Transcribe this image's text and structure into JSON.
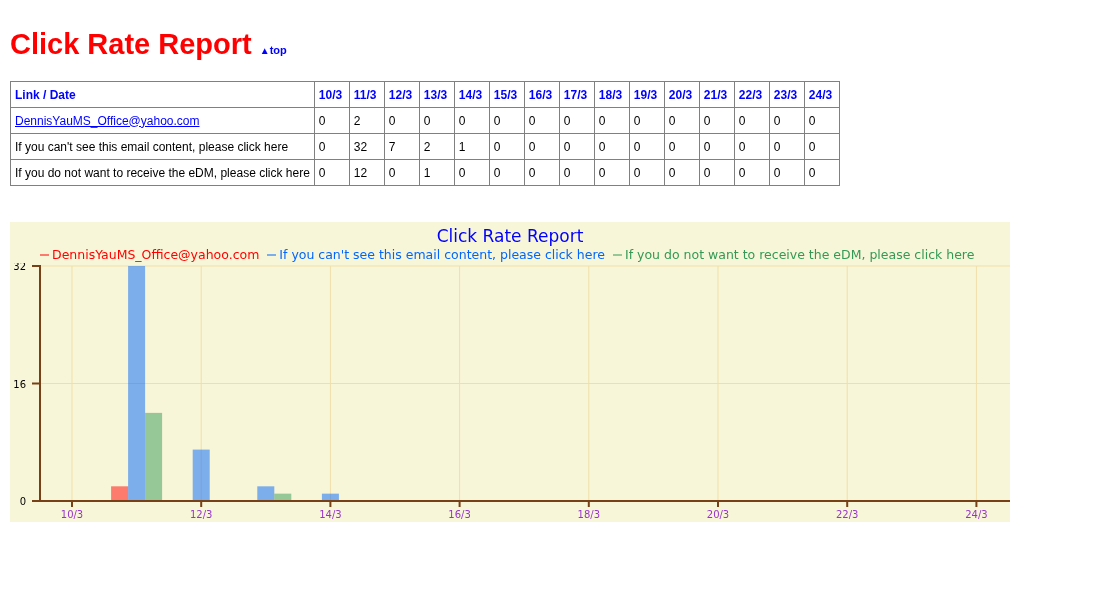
{
  "title": "Click Rate Report",
  "top_link": {
    "icon": "▲",
    "label": "top"
  },
  "table": {
    "columns": [
      "Link / Date",
      "10/3",
      "11/3",
      "12/3",
      "13/3",
      "14/3",
      "15/3",
      "16/3",
      "17/3",
      "18/3",
      "19/3",
      "20/3",
      "21/3",
      "22/3",
      "23/3",
      "24/3"
    ],
    "rows": [
      {
        "kind": "link",
        "cells": [
          "DennisYauMS_Office@yahoo.com",
          "0",
          "2",
          "0",
          "0",
          "0",
          "0",
          "0",
          "0",
          "0",
          "0",
          "0",
          "0",
          "0",
          "0",
          "0"
        ]
      },
      {
        "kind": "text",
        "cells": [
          "If you can't see this email content, please click here",
          "0",
          "32",
          "7",
          "2",
          "1",
          "0",
          "0",
          "0",
          "0",
          "0",
          "0",
          "0",
          "0",
          "0",
          "0"
        ]
      },
      {
        "kind": "text",
        "cells": [
          "If you do not want to receive the eDM, please click here",
          "0",
          "12",
          "0",
          "1",
          "0",
          "0",
          "0",
          "0",
          "0",
          "0",
          "0",
          "0",
          "0",
          "0",
          "0"
        ]
      }
    ]
  },
  "chart_data": {
    "type": "bar",
    "title": "Click Rate Report",
    "categories": [
      "10/3",
      null,
      "12/3",
      null,
      "14/3",
      null,
      "16/3",
      null,
      "18/3",
      null,
      "20/3",
      null,
      "22/3",
      null,
      "24/3"
    ],
    "series": [
      {
        "name": "DennisYauMS_Office@yahoo.com",
        "color": "#ff0000",
        "values": [
          0,
          2,
          0,
          0,
          0,
          0,
          0,
          0,
          0,
          0,
          0,
          0,
          0,
          0,
          0
        ]
      },
      {
        "name": "If you can't see this email content, please click here",
        "color": "#0066ff",
        "values": [
          0,
          32,
          7,
          2,
          1,
          0,
          0,
          0,
          0,
          0,
          0,
          0,
          0,
          0,
          0
        ]
      },
      {
        "name": "If you do not want to receive the eDM, please click here",
        "color": "#339955",
        "values": [
          0,
          12,
          0,
          1,
          0,
          0,
          0,
          0,
          0,
          0,
          0,
          0,
          0,
          0,
          0
        ]
      }
    ],
    "ylim": [
      0,
      32
    ],
    "yticks": [
      {
        "value": 0,
        "label": "0"
      },
      {
        "value": 16,
        "label": "16"
      },
      {
        "value": 32,
        "label": "32"
      }
    ],
    "grid": true,
    "legend": true
  }
}
